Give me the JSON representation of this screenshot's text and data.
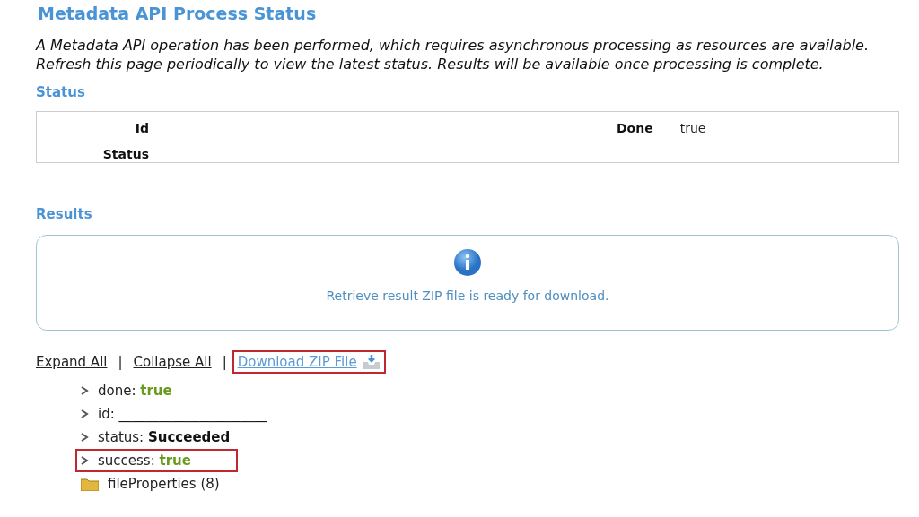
{
  "title": "Metadata API Process Status",
  "description": "A Metadata API operation has been performed, which requires asynchronous processing as resources are available. Refresh this page periodically to view the latest status. Results will be available once processing is complete.",
  "status_section": {
    "heading": "Status",
    "fields": [
      {
        "label": "Id"
      },
      {
        "label": "Status"
      }
    ],
    "done": {
      "label": "Done",
      "value": "true"
    }
  },
  "results_section": {
    "heading": "Results",
    "message": "Retrieve result ZIP file is ready for download."
  },
  "links": [
    {
      "label": "Expand All",
      "kind": "plain",
      "highlighted": false
    },
    {
      "label": "Collapse All",
      "kind": "plain",
      "highlighted": false
    },
    {
      "label": "Download ZIP File",
      "kind": "download",
      "highlighted": true
    }
  ],
  "separator": "|",
  "tree": [
    {
      "kind": "leaf",
      "key": "done:",
      "value": {
        "text": "true",
        "kind": "bool"
      },
      "highlighted": false
    },
    {
      "kind": "leaf",
      "key": "id:",
      "value": {
        "text": "______________________",
        "kind": "plain"
      },
      "highlighted": false
    },
    {
      "kind": "leaf",
      "key": "status:",
      "value": {
        "text": "Succeeded",
        "kind": "bold"
      },
      "highlighted": false
    },
    {
      "kind": "leaf",
      "key": "success:",
      "value": {
        "text": "true",
        "kind": "bool"
      },
      "highlighted": true
    },
    {
      "kind": "folder",
      "key": "fileProperties (8)",
      "highlighted": false
    }
  ]
}
